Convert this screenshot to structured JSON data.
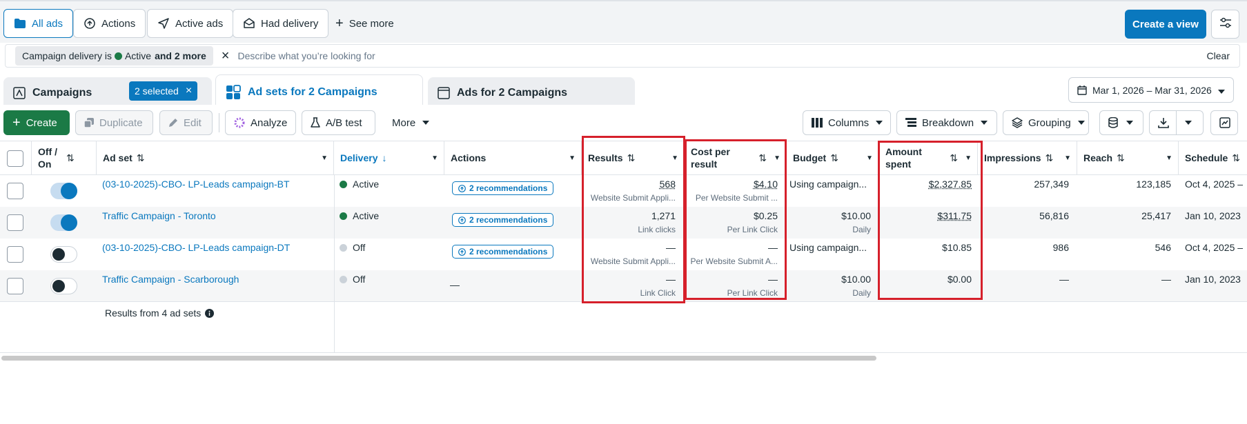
{
  "top_chips": [
    {
      "label": "All ads",
      "icon": "folder-icon"
    },
    {
      "label": "Actions",
      "icon": "actions-icon"
    },
    {
      "label": "Active ads",
      "icon": "send-icon"
    },
    {
      "label": "Had delivery",
      "icon": "inbox-icon"
    }
  ],
  "see_more": "See more",
  "create_view": "Create a view",
  "filter": {
    "prefix": "Campaign delivery is",
    "status": "Active",
    "more": "and 2 more",
    "placeholder": "Describe what you’re looking for",
    "clear": "Clear"
  },
  "tabs": {
    "campaigns": "Campaigns",
    "selected": "2 selected",
    "adsets": "Ad sets for 2 Campaigns",
    "ads": "Ads for 2 Campaigns"
  },
  "date_range": "Mar 1, 2026 – Mar 31, 2026",
  "toolbar": {
    "create": "Create",
    "duplicate": "Duplicate",
    "edit": "Edit",
    "analyze": "Analyze",
    "ab_test": "A/B test",
    "more": "More",
    "columns": "Columns",
    "breakdown": "Breakdown",
    "grouping": "Grouping"
  },
  "headers": {
    "off_on": "Off / On",
    "ad_set": "Ad set",
    "delivery": "Delivery",
    "actions": "Actions",
    "results": "Results",
    "cost_per_result_1": "Cost per",
    "cost_per_result_2": "result",
    "budget": "Budget",
    "amount_spent_1": "Amount",
    "amount_spent_2": "spent",
    "impressions": "Impressions",
    "reach": "Reach",
    "schedule": "Schedule"
  },
  "rows": [
    {
      "on": true,
      "name": "(03-10-2025)-CBO- LP-Leads campaign-BT",
      "delivery": "Active",
      "actions": "2 recommendations",
      "results": "568",
      "results_sub": "Website Submit Appli...",
      "cost": "$4.10",
      "cost_sub": "Per Website Submit ...",
      "budget": "Using campaign...",
      "budget_sub": "",
      "spent": "$2,327.85",
      "impressions": "257,349",
      "reach": "123,185",
      "schedule": "Oct 4, 2025 –"
    },
    {
      "on": true,
      "name": "Traffic Campaign - Toronto",
      "delivery": "Active",
      "actions": "2 recommendations",
      "results": "1,271",
      "results_sub": "Link clicks",
      "cost": "$0.25",
      "cost_sub": "Per Link Click",
      "budget": "$10.00",
      "budget_sub": "Daily",
      "spent": "$311.75",
      "impressions": "56,816",
      "reach": "25,417",
      "schedule": "Jan 10, 2023"
    },
    {
      "on": false,
      "name": "(03-10-2025)-CBO- LP-Leads campaign-DT",
      "delivery": "Off",
      "actions": "2 recommendations",
      "results": "—",
      "results_sub": "Website Submit Appli...",
      "cost": "—",
      "cost_sub": "Per Website Submit A...",
      "budget": "Using campaign...",
      "budget_sub": "",
      "spent": "$10.85",
      "impressions": "986",
      "reach": "546",
      "schedule": "Oct 4, 2025 –"
    },
    {
      "on": false,
      "name": "Traffic Campaign - Scarborough",
      "delivery": "Off",
      "actions": "—",
      "results": "—",
      "results_sub": "Link Click",
      "cost": "—",
      "cost_sub": "Per Link Click",
      "budget": "$10.00",
      "budget_sub": "Daily",
      "spent": "$0.00",
      "impressions": "—",
      "reach": "—",
      "schedule": "Jan 10, 2023"
    }
  ],
  "footer": "Results from 4 ad sets",
  "colors": {
    "accent": "#0a78be",
    "active": "#1b7a46",
    "off": "#cbd2d9",
    "highlight": "#d6202b"
  }
}
